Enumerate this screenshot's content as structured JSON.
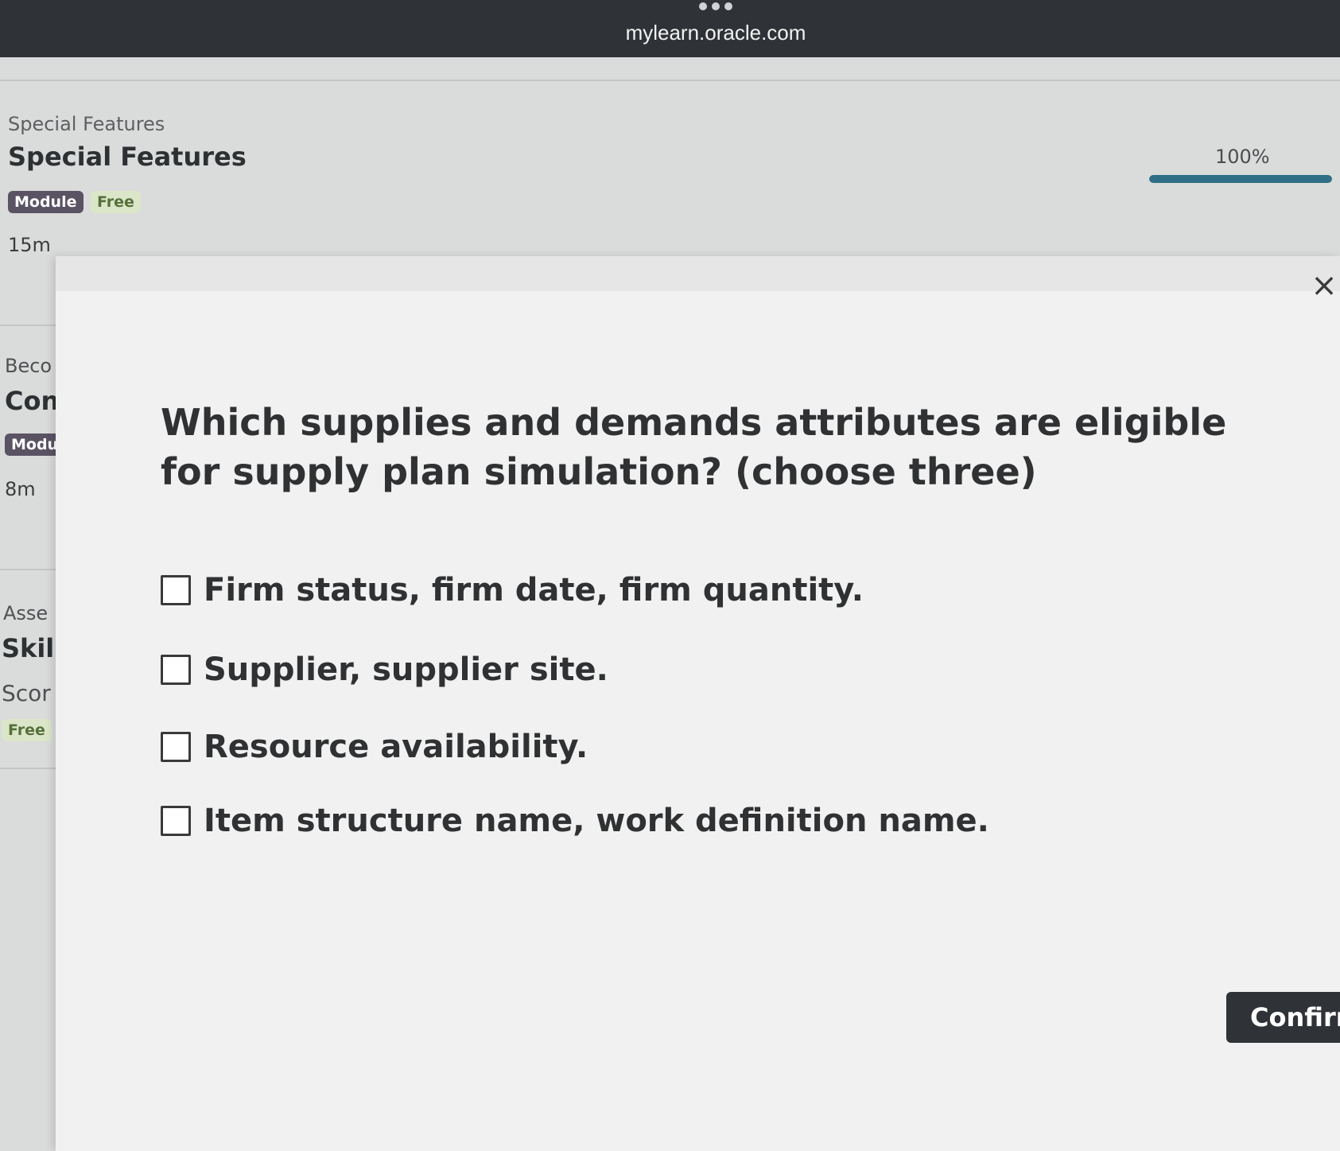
{
  "browser": {
    "url": "mylearn.oracle.com"
  },
  "background": {
    "items": [
      {
        "label": "Special Features",
        "title": "Special Features",
        "badges": [
          "Module",
          "Free"
        ],
        "duration": "15m"
      },
      {
        "label": "Beco",
        "title": "Con",
        "badges": [
          "Modu"
        ],
        "duration": "8m"
      },
      {
        "label": "Asse",
        "title": "Skil",
        "score": "Scor",
        "badges": [
          "Free"
        ]
      }
    ],
    "progress": {
      "label": "100%",
      "value": 1.0
    }
  },
  "modal": {
    "question": "Which supplies and demands attributes are eligible for supply plan simulation? (choose three)",
    "options": [
      "Firm status, firm date, firm quantity.",
      "Supplier, supplier site.",
      "Resource availability.",
      "Item structure name, work definition name."
    ],
    "close_icon": "close-icon",
    "confirm_label": "Confirm"
  }
}
